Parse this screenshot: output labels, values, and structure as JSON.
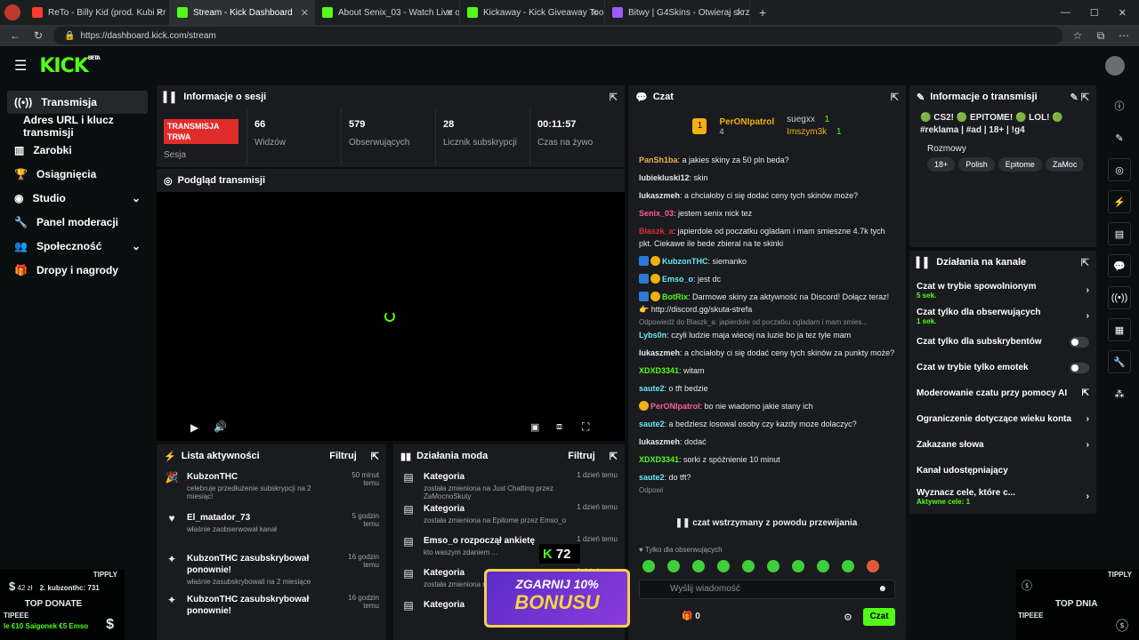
{
  "browser": {
    "tabs": [
      {
        "label": "ReTo - Billy Kid (prod. Kubi Pr",
        "color": "#ff3b30"
      },
      {
        "label": "Stream - Kick Dashboard",
        "color": "#53fc18"
      },
      {
        "label": "About Senix_03 - Watch Live on K",
        "color": "#53fc18"
      },
      {
        "label": "Kickaway - Kick Giveaway Tool",
        "color": "#53fc18"
      },
      {
        "label": "Bitwy | G4Skins - Otwieraj skrzynki",
        "color": "#9b5cff"
      }
    ],
    "url": "https://dashboard.kick.com/stream"
  },
  "brand": {
    "name": "KICK",
    "beta": "BETA",
    "accent": "#53fc18"
  },
  "sidebar": {
    "items": [
      "Transmisja",
      "Adres URL i klucz transmisji",
      "Zarobki",
      "Osiągnięcia",
      "Studio",
      "Panel moderacji",
      "Społeczność",
      "Dropy i nagrody"
    ]
  },
  "session": {
    "title": "Informacje o sesji",
    "live_label": "TRANSMISJA TRWA",
    "session_label": "Sesja",
    "stats": [
      {
        "value": "66",
        "label": "Widzów"
      },
      {
        "value": "579",
        "label": "Obserwujących"
      },
      {
        "value": "28",
        "label": "Licznik subskrypcji"
      },
      {
        "value": "00:11:57",
        "label": "Czas na żywo"
      }
    ]
  },
  "preview": {
    "title": "Podgląd transmisji"
  },
  "activity": {
    "title": "Lista aktywności",
    "filter": "Filtruj",
    "items": [
      {
        "title": "KubzonTHC",
        "sub": "celebruje przedłużenie subskrypcji na 2 miesiąc!",
        "time": "50 minut temu",
        "icon": "party-icon"
      },
      {
        "title": "El_matador_73",
        "sub": "właśnie zaobserwował kanał",
        "time": "5 godzin temu",
        "icon": "heart-icon"
      },
      {
        "title": "KubzonTHC zasubskrybował ponownie!",
        "sub": "właśnie zasubskrybowali na 2 miesiące",
        "time": "16 godzin temu",
        "icon": "star-icon"
      },
      {
        "title": "KubzonTHC zasubskrybował ponownie!",
        "sub": "",
        "time": "16 godzin temu",
        "icon": "star-icon"
      }
    ]
  },
  "mod": {
    "title": "Działania moda",
    "filter": "Filtruj",
    "items": [
      {
        "title": "Kategoria",
        "sub": "została zmieniona na Just Chatting przez ZaMocnoSkuty",
        "time": "1 dzień temu"
      },
      {
        "title": "Kategoria",
        "sub": "została zmieniona na Epitome przez Emso_o",
        "time": "1 dzień temu"
      },
      {
        "title": "Emso_o rozpoczął ankietę",
        "sub": "kto waszym zdaniem ...",
        "time": "1 dzień temu"
      },
      {
        "title": "Kategoria",
        "sub": "została zmieniona na ... ZaMocnoSkuty",
        "time": "1 dzień temu"
      },
      {
        "title": "Kategoria",
        "sub": "",
        "time": ""
      }
    ]
  },
  "chat": {
    "title": "Czat",
    "top": [
      {
        "name": "PerONIpatrol",
        "count": "4"
      },
      {
        "name": "suegxx",
        "count": "1"
      },
      {
        "name": "Imszym3k",
        "count": "1"
      }
    ],
    "messages": [
      {
        "user": "PanSh1ba",
        "color": "#e8b34f",
        "text": "a jakies skiny za 50 pln beda?"
      },
      {
        "user": "lubiekluski12",
        "color": "#e8eaeb",
        "text": "skin"
      },
      {
        "user": "lukaszmeh",
        "color": "#e8eaeb",
        "text": "a chciałoby ci się dodać ceny tych skinów może?"
      },
      {
        "user": "Senix_03",
        "color": "#ff5d8f",
        "text": "jestem senix nick tez"
      },
      {
        "user": "Blaszk_a",
        "color": "#e12c2c",
        "text": "japierdole od poczatku ogladam i mam smieszne 4.7k tych pkt. Ciekawe ile bede zbieral na te skinki"
      },
      {
        "user": "KubzonTHC",
        "color": "#67e9f4",
        "text": "siemanko"
      },
      {
        "user": "Emso_o",
        "color": "#67e9f4",
        "text": "jest dc"
      },
      {
        "user": "BotRix",
        "color": "#53fc18",
        "text": "Darmowe skiny za aktywność na Discord! Dołącz teraz! 👉 http://discord.gg/skuta-strefa"
      },
      {
        "user": "Lybs0n",
        "color": "#67e9f4",
        "text": "czyli ludzie maja wiecej na luzie bo ja tez tyle mam"
      },
      {
        "user": "lukaszmeh",
        "color": "#e8eaeb",
        "text": "a chciałoby ci się dodać ceny tych skinów za punkty może?"
      },
      {
        "user": "XDXD3341",
        "color": "#53fc18",
        "text": "witam"
      },
      {
        "user": "saute2",
        "color": "#67e9f4",
        "text": "o tft bedzie"
      },
      {
        "user": "PerONIpatrol",
        "color": "#ff5d8f",
        "text": "bo nie wiadomo jakie stany ich"
      },
      {
        "user": "saute2",
        "color": "#67e9f4",
        "text": "a bedziesz losowal osoby czy kazdy moze dolaczyc?"
      },
      {
        "user": "lukaszmeh",
        "color": "#e8eaeb",
        "text": "dodać"
      },
      {
        "user": "XDXD3341",
        "color": "#53fc18",
        "text": "sorki z spóźnienie 10 minut"
      },
      {
        "user": "saute2",
        "color": "#67e9f4",
        "text": "do tft?"
      }
    ],
    "reply1": "Odpowiedź do Blaszk_a: japierdole od poczatku ogladam i mam smies...",
    "reply2": "Odpowi",
    "paused": "czat wstrzymany z powodu przewijania",
    "followers_only": "Tylko dla obserwujących",
    "placeholder": "Wyślij wiadomość",
    "points": "0",
    "send": "Czat"
  },
  "stream_info": {
    "title": "Informacje o transmisji",
    "stream_title": "🟢 CS2! 🟢 EPITOME! 🟢 LOL! 🟢 #reklama | #ad | 18+ | !g4",
    "category": "Rozmowy",
    "tags": [
      "18+",
      "Polish",
      "Epitome",
      "ZaMoc"
    ]
  },
  "actions": {
    "title": "Działania na kanale",
    "rows": [
      {
        "label": "Czat w trybie spowolnionym",
        "sub": "5 sek.",
        "ctrl": "chevron"
      },
      {
        "label": "Czat tylko dla obserwujących",
        "sub": "1 sek.",
        "ctrl": "chevron"
      },
      {
        "label": "Czat tylko dla subskrybentów",
        "sub": "",
        "ctrl": "toggle"
      },
      {
        "label": "Czat w trybie tylko emotek",
        "sub": "",
        "ctrl": "toggle"
      },
      {
        "label": "Moderowanie czatu przy pomocy AI",
        "sub": "",
        "ctrl": "external"
      },
      {
        "label": "Ograniczenie dotyczące wieku konta",
        "sub": "",
        "ctrl": "chevron"
      },
      {
        "label": "Zakazane słowa",
        "sub": "",
        "ctrl": "chevron"
      },
      {
        "label": "Kanał udostępniający",
        "sub": "",
        "ctrl": "none"
      },
      {
        "label": "Wyznacz cele, które c...",
        "sub": "Aktywne cele: 1",
        "ctrl": "chevron"
      }
    ]
  },
  "overlay": {
    "tipply": "TIPPLY",
    "amount": "42 zł",
    "top_user": "2. kubzonthc: 731",
    "top_donate": "TOP DONATE",
    "tipeee": "TIPEEE",
    "donors": "€10 Saigonek  €5 Emso",
    "prefix": "le",
    "kick_count": "72",
    "banner1": "ZGARNIJ 10%",
    "banner2": "BONUSU",
    "tipply_r": "TIPPLY",
    "top_dnia": "TOP DNIA",
    "tipeee_r": "TIPEEE"
  }
}
